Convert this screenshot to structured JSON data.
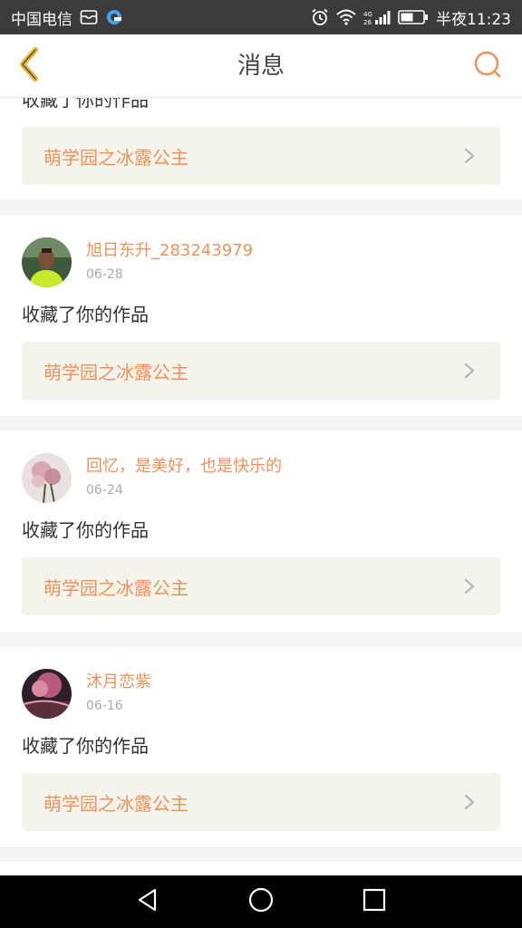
{
  "status_bar": {
    "carrier": "中国电信",
    "time": "半夜11:23",
    "icons": [
      "mail-icon",
      "app-icon",
      "alarm-icon",
      "wifi-icon",
      "signal-icon",
      "battery-icon"
    ]
  },
  "header": {
    "title": "消息",
    "back_icon": "chevron-left-icon",
    "search_icon": "search-icon",
    "accent_color": "#f0925c"
  },
  "partial_top": {
    "action_text": "收藏了你的作品",
    "work_title": "萌学园之冰露公主"
  },
  "messages": [
    {
      "username": "旭日东升_283243979",
      "date": "06-28",
      "action_text": "收藏了你的作品",
      "work_title": "萌学园之冰露公主"
    },
    {
      "username": "回忆，是美好，也是快乐的",
      "date": "06-24",
      "action_text": "收藏了你的作品",
      "work_title": "萌学园之冰露公主"
    },
    {
      "username": "沐月恋紫",
      "date": "06-16",
      "action_text": "收藏了你的作品",
      "work_title": "萌学园之冰露公主"
    }
  ],
  "nav_bar": {
    "back": "nav-back-icon",
    "home": "nav-home-icon",
    "recent": "nav-recent-icon"
  }
}
